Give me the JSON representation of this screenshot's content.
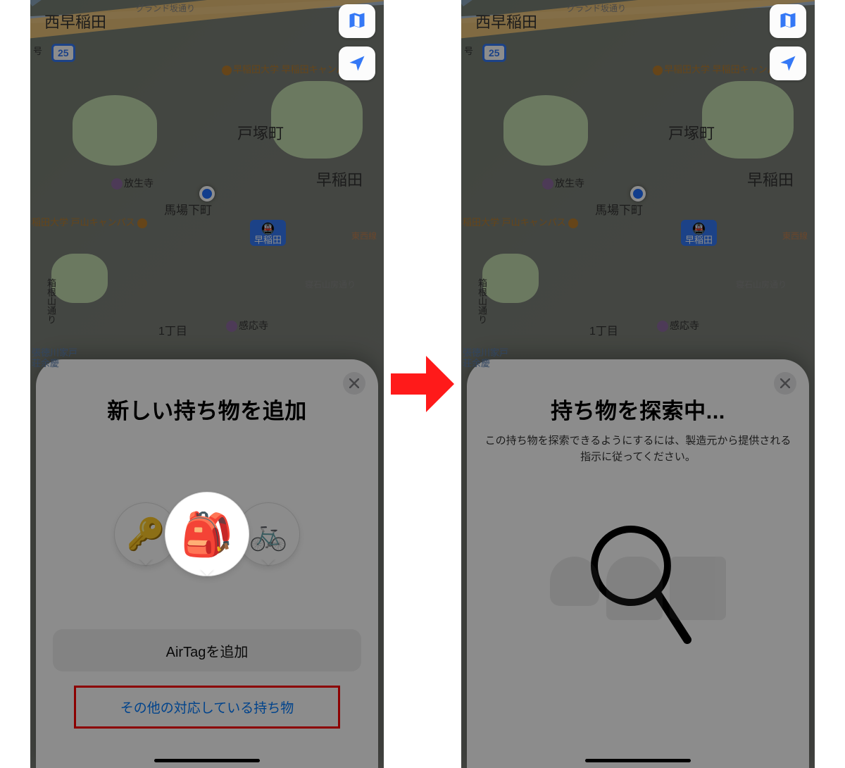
{
  "map": {
    "labels": {
      "nishi_waseda": "西早稲田",
      "totsuka": "戸塚町",
      "waseda": "早稲田",
      "baba_shita": "馬場下町",
      "hakone": "箱根山通り",
      "one_chome": "1丁目",
      "grand_slope": "グランド坂通り",
      "waseda_campus_label": "早稲田大学 早稲田キャンパ",
      "waseda_toyama": "稲田大学 戸山キャンパス",
      "hojoji": "放生寺",
      "kanoji": "感応寺",
      "tozai_line": "東西線",
      "tokubetsu": "張徳川家戸",
      "soukane": "荘余慶",
      "neishi_st": "寝石山房通り",
      "station_waseda": "早稲田",
      "route_25": "25",
      "side_label": "号"
    }
  },
  "sheet_left": {
    "title": "新しい持ち物を追加",
    "button_add_airtag": "AirTagを追加",
    "button_other": "その他の対応している持ち物",
    "icons": {
      "key": "🔑",
      "backpack": "🎒",
      "bike": "🚲"
    }
  },
  "sheet_right": {
    "title": "持ち物を探索中...",
    "subtitle": "この持ち物を探索できるようにするには、製造元から提供される指示に従ってください。"
  }
}
